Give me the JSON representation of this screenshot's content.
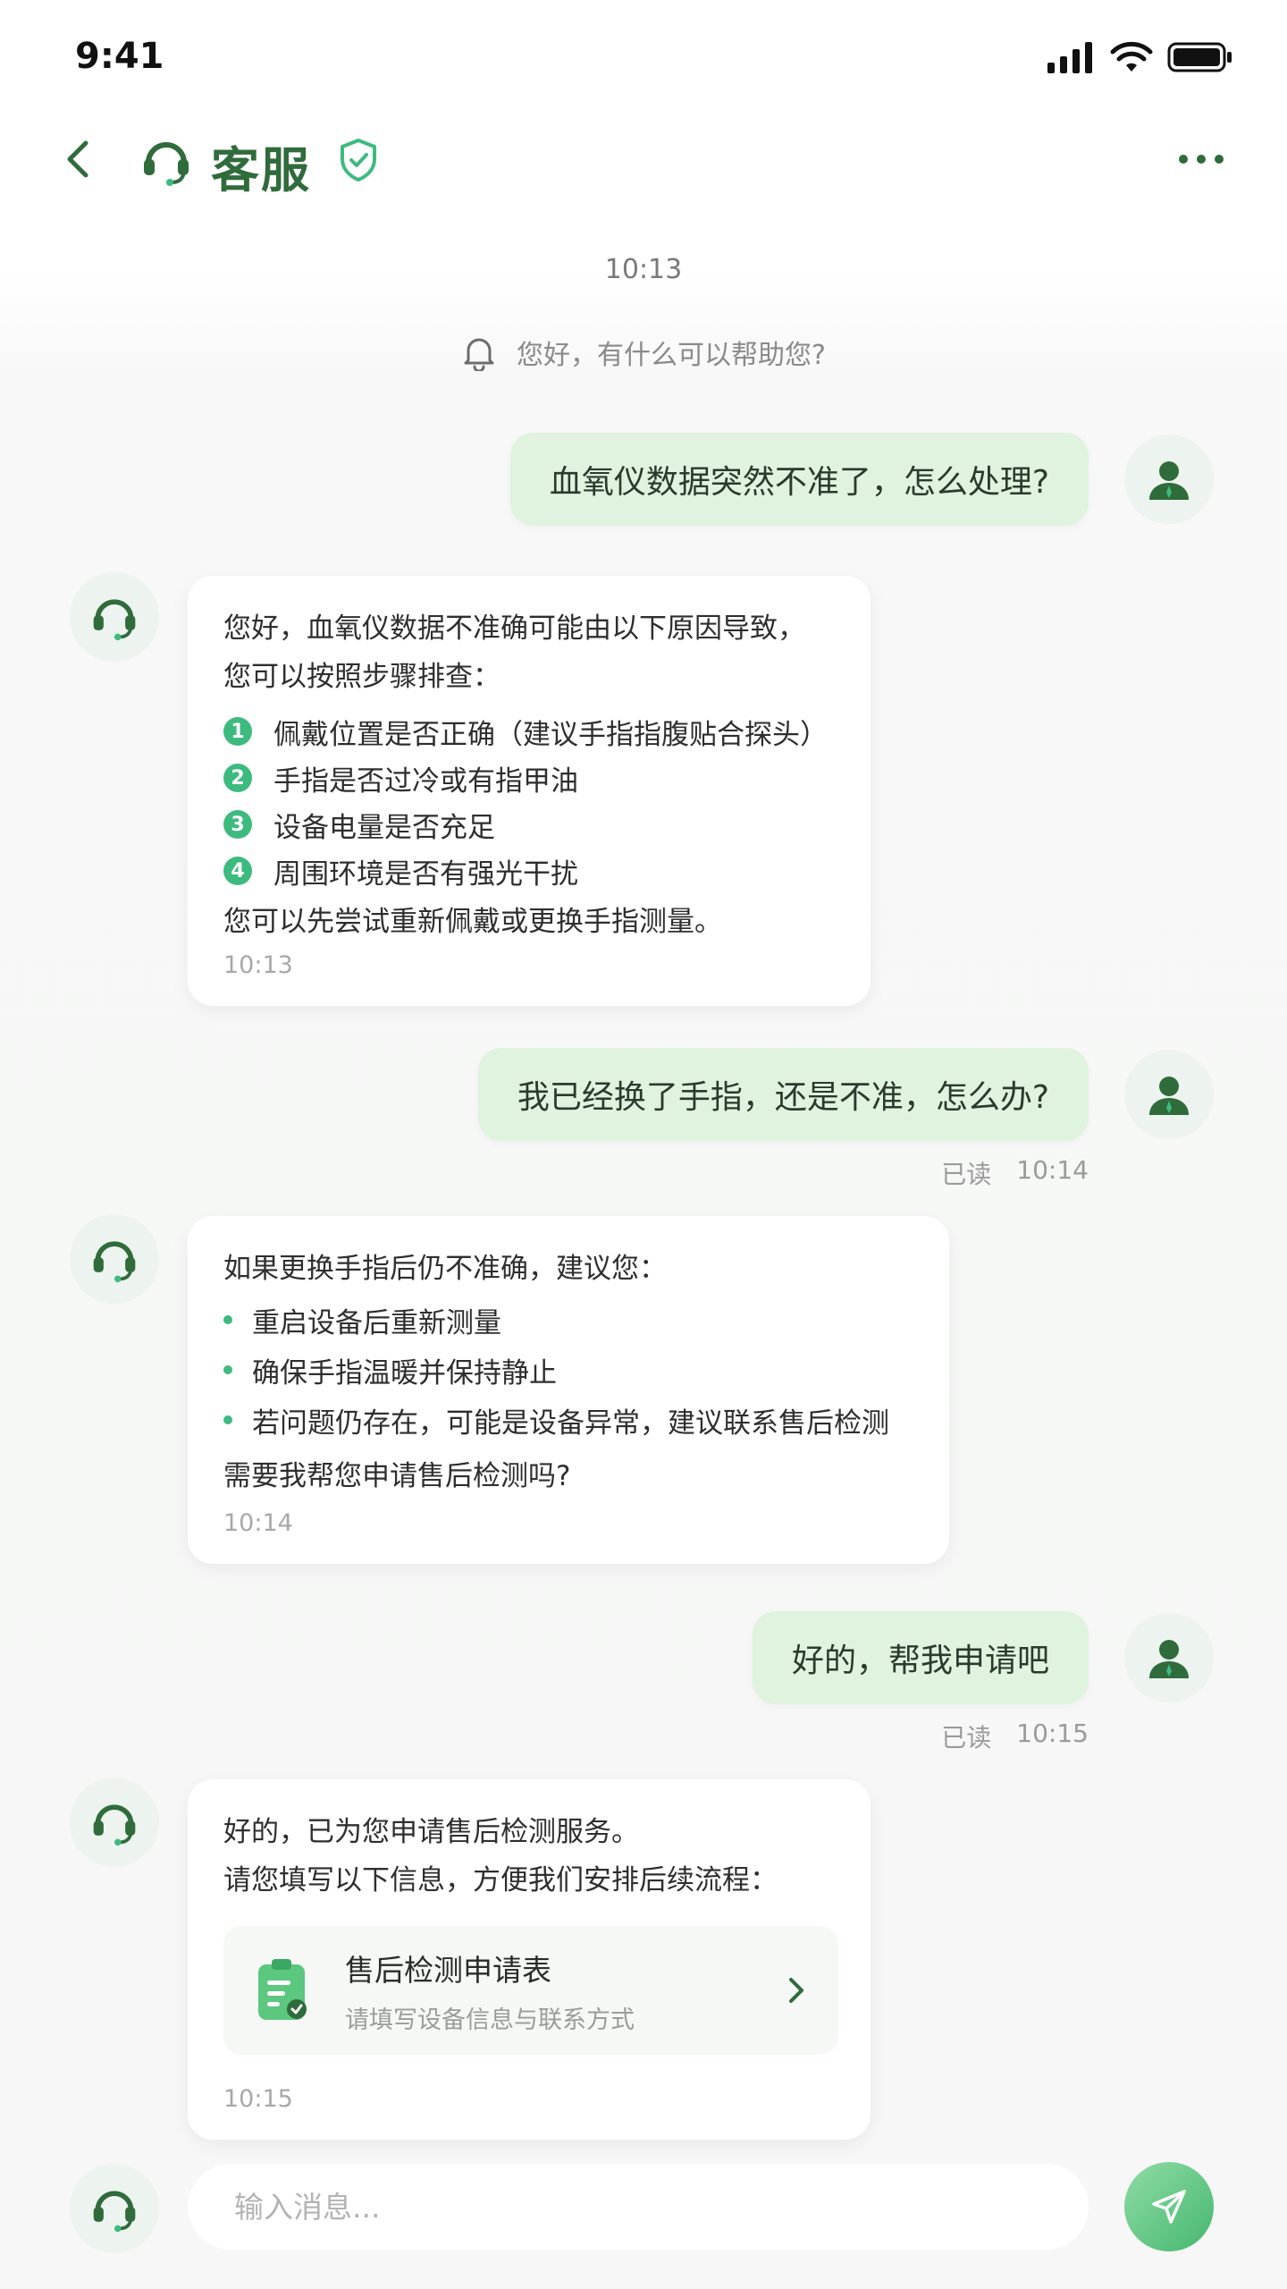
{
  "status_bar": {
    "time": "9:41"
  },
  "header": {
    "title": "客服"
  },
  "chat": {
    "start_time": "10:13",
    "system_notice": "您好，有什么可以帮助您?",
    "messages": [
      {
        "from": "user",
        "text": "血氧仪数据突然不准了，怎么处理?"
      },
      {
        "from": "agent",
        "intro_1": "您好，血氧仪数据不准确可能由以下原因导致，",
        "intro_2": "您可以按照步骤排查：",
        "steps": [
          {
            "num": "1",
            "text": "佩戴位置是否正确（建议手指指腹贴合探头）"
          },
          {
            "num": "2",
            "text": "手指是否过冷或有指甲油"
          },
          {
            "num": "3",
            "text": "设备电量是否充足"
          },
          {
            "num": "4",
            "text": "周围环境是否有强光干扰"
          }
        ],
        "outro": "您可以先尝试重新佩戴或更换手指测量。",
        "time": "10:13"
      },
      {
        "from": "user",
        "text": "我已经换了手指，还是不准，怎么办?",
        "read": "已读",
        "time": "10:14"
      },
      {
        "from": "agent",
        "intro": "如果更换手指后仍不准确，建议您：",
        "bullets": [
          "重启设备后重新测量",
          "确保手指温暖并保持静止",
          "若问题仍存在，可能是设备异常，建议联系售后检测"
        ],
        "outro": "需要我帮您申请售后检测吗?",
        "time": "10:14"
      },
      {
        "from": "user",
        "text": "好的，帮我申请吧",
        "read": "已读",
        "time": "10:15"
      },
      {
        "from": "agent",
        "line_1": "好的，已为您申请售后检测服务。",
        "line_2": "请您填写以下信息，方便我们安排后续流程：",
        "form_card": {
          "title": "售后检测申请表",
          "subtitle": "请填写设备信息与联系方式"
        },
        "time": "10:15"
      }
    ]
  },
  "input": {
    "placeholder": "输入消息..."
  },
  "colors": {
    "brand_green": "#2f6b3b",
    "accent_green": "#3dbb7f",
    "user_bubble": "#dff3de"
  },
  "icons": [
    "back-arrow-icon",
    "headset-icon",
    "shield-check-icon",
    "more-dots-icon",
    "bell-icon",
    "user-icon",
    "form-icon",
    "chevron-right-icon",
    "send-icon"
  ]
}
